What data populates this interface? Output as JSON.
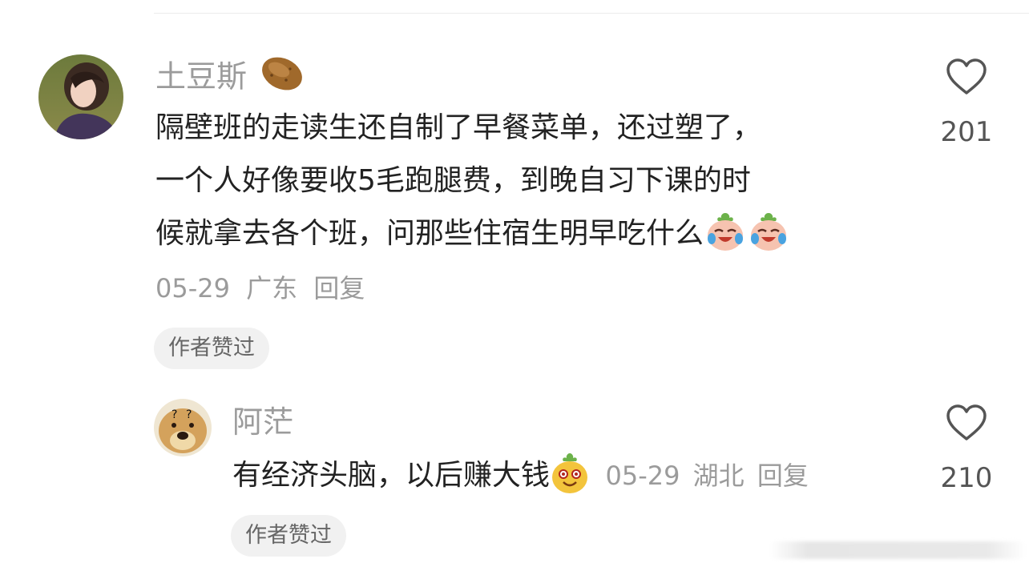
{
  "comments": [
    {
      "username": "土豆斯",
      "username_emoji": "potato-emoji",
      "content_lines": [
        "隔壁班的走读生还自制了早餐菜单，还过塑了，",
        "一个人好像要收5毛跑腿费，到晚自习下课的时",
        "候就拿去各个班，问那些住宿生明早吃什么"
      ],
      "content_emojis": [
        "crying-laughing-emoji",
        "crying-laughing-emoji"
      ],
      "date": "05-29",
      "location": "广东",
      "reply_label": "回复",
      "badge": "作者赞过",
      "likes": "201"
    },
    {
      "username": "阿茫",
      "content": "有经济头脑，以后赚大钱",
      "content_emoji": "laughing-face-emoji",
      "date": "05-29",
      "location": "湖北",
      "reply_label": "回复",
      "badge": "作者赞过",
      "likes": "210"
    }
  ],
  "icons": {
    "like": "heart-outline-icon"
  },
  "colors": {
    "text_primary": "#222222",
    "text_secondary": "#9b9b9b",
    "badge_bg": "#f1f1f1"
  }
}
